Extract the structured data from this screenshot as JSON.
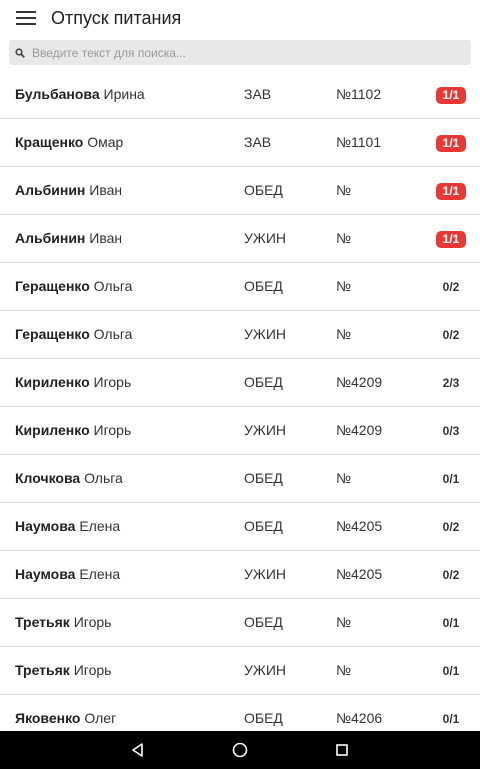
{
  "app": {
    "title": "Отпуск питания"
  },
  "search": {
    "placeholder": "Введите текст для поиска..."
  },
  "rows": [
    {
      "last": "Бульбанова",
      "first": "Ирина",
      "meal": "ЗАВ",
      "num": "№1102",
      "badge": "1/1",
      "badge_red": true
    },
    {
      "last": "Кращенко",
      "first": "Омар",
      "meal": "ЗАВ",
      "num": "№1101",
      "badge": "1/1",
      "badge_red": true
    },
    {
      "last": "Альбинин",
      "first": "Иван",
      "meal": "ОБЕД",
      "num": "№",
      "badge": "1/1",
      "badge_red": true
    },
    {
      "last": "Альбинин",
      "first": "Иван",
      "meal": "УЖИН",
      "num": "№",
      "badge": "1/1",
      "badge_red": true
    },
    {
      "last": "Геращенко",
      "first": "Ольга",
      "meal": "ОБЕД",
      "num": "№",
      "badge": "0/2",
      "badge_red": false
    },
    {
      "last": "Геращенко",
      "first": "Ольга",
      "meal": "УЖИН",
      "num": "№",
      "badge": "0/2",
      "badge_red": false
    },
    {
      "last": "Кириленко",
      "first": "Игорь",
      "meal": "ОБЕД",
      "num": "№4209",
      "badge": "2/3",
      "badge_red": false
    },
    {
      "last": "Кириленко",
      "first": "Игорь",
      "meal": "УЖИН",
      "num": "№4209",
      "badge": "0/3",
      "badge_red": false
    },
    {
      "last": "Клочкова",
      "first": "Ольга",
      "meal": "ОБЕД",
      "num": "№",
      "badge": "0/1",
      "badge_red": false
    },
    {
      "last": "Наумова",
      "first": "Елена",
      "meal": "ОБЕД",
      "num": "№4205",
      "badge": "0/2",
      "badge_red": false
    },
    {
      "last": "Наумова",
      "first": "Елена",
      "meal": "УЖИН",
      "num": "№4205",
      "badge": "0/2",
      "badge_red": false
    },
    {
      "last": "Третьяк",
      "first": "Игорь",
      "meal": "ОБЕД",
      "num": "№",
      "badge": "0/1",
      "badge_red": false
    },
    {
      "last": "Третьяк",
      "first": "Игорь",
      "meal": "УЖИН",
      "num": "№",
      "badge": "0/1",
      "badge_red": false
    },
    {
      "last": "Яковенко",
      "first": "Олег",
      "meal": "ОБЕД",
      "num": "№4206",
      "badge": "0/1",
      "badge_red": false
    }
  ],
  "colors": {
    "badge_red": "#e53935",
    "divider": "#dddddd",
    "search_bg": "#e8e8e8",
    "navbar": "#000000"
  },
  "icons": {
    "menu": "hamburger-menu-icon",
    "search": "search-icon",
    "back": "back-triangle-icon",
    "home": "home-circle-icon",
    "recents": "recents-square-icon"
  }
}
